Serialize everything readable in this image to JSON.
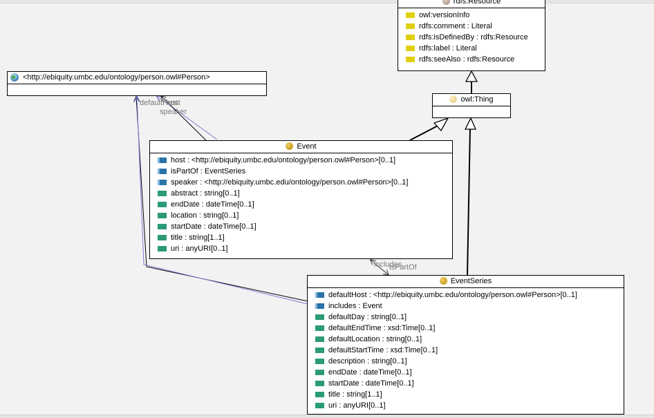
{
  "diagram": {
    "classes": {
      "resource": {
        "title": "rdfs:Resource",
        "props": [
          {
            "icon": "annotation-property-icon",
            "text": "owl:versionInfo"
          },
          {
            "icon": "annotation-property-icon",
            "text": "rdfs:comment : Literal"
          },
          {
            "icon": "annotation-property-icon",
            "text": "rdfs:isDefinedBy : rdfs:Resource"
          },
          {
            "icon": "annotation-property-icon",
            "text": "rdfs:label : Literal"
          },
          {
            "icon": "annotation-property-icon",
            "text": "rdfs:seeAlso : rdfs:Resource"
          }
        ]
      },
      "person": {
        "title": "<http://ebiquity.umbc.edu/ontology/person.owl#Person>",
        "props": []
      },
      "thing": {
        "title": "owl:Thing",
        "props": []
      },
      "event": {
        "title": "Event",
        "props": [
          {
            "icon": "object-property-icon",
            "text": "host : <http://ebiquity.umbc.edu/ontology/person.owl#Person>[0..1]"
          },
          {
            "icon": "object-property-icon",
            "text": "isPartOf : EventSeries"
          },
          {
            "icon": "object-property-icon",
            "text": "speaker : <http://ebiquity.umbc.edu/ontology/person.owl#Person>[0..1]"
          },
          {
            "icon": "datatype-property-icon",
            "text": "abstract : string[0..1]"
          },
          {
            "icon": "datatype-property-icon",
            "text": "endDate : dateTime[0..1]"
          },
          {
            "icon": "datatype-property-icon",
            "text": "location : string[0..1]"
          },
          {
            "icon": "datatype-property-icon",
            "text": "startDate : dateTime[0..1]"
          },
          {
            "icon": "datatype-property-icon",
            "text": "title : string[1..1]"
          },
          {
            "icon": "datatype-property-icon",
            "text": "uri : anyURI[0..1]"
          }
        ]
      },
      "eventseries": {
        "title": "EventSeries",
        "props": [
          {
            "icon": "object-property-icon",
            "text": "defaultHost : <http://ebiquity.umbc.edu/ontology/person.owl#Person>[0..1]"
          },
          {
            "icon": "object-property-icon",
            "text": "includes : Event"
          },
          {
            "icon": "datatype-property-icon",
            "text": "defaultDay : string[0..1]"
          },
          {
            "icon": "datatype-property-icon",
            "text": "defaultEndTime : xsd:Time[0..1]"
          },
          {
            "icon": "datatype-property-icon",
            "text": "defaultLocation : string[0..1]"
          },
          {
            "icon": "datatype-property-icon",
            "text": "defaultStartTime : xsd:Time[0..1]"
          },
          {
            "icon": "datatype-property-icon",
            "text": "description : string[0..1]"
          },
          {
            "icon": "datatype-property-icon",
            "text": "endDate : dateTime[0..1]"
          },
          {
            "icon": "datatype-property-icon",
            "text": "startDate : dateTime[0..1]"
          },
          {
            "icon": "datatype-property-icon",
            "text": "title : string[1..1]"
          },
          {
            "icon": "datatype-property-icon",
            "text": "uri : anyURI[0..1]"
          }
        ]
      }
    },
    "edge_labels": {
      "default_host": "defaultHost",
      "host": "host",
      "speaker": "speaker",
      "includes": "includes",
      "is_part_of": "isPartOf"
    },
    "colors": {
      "object_property": "#2a72a8",
      "datatype_property": "#2a9a78",
      "annotation_property": "#e0cf10",
      "property_edge": "#7b7bd6"
    }
  }
}
